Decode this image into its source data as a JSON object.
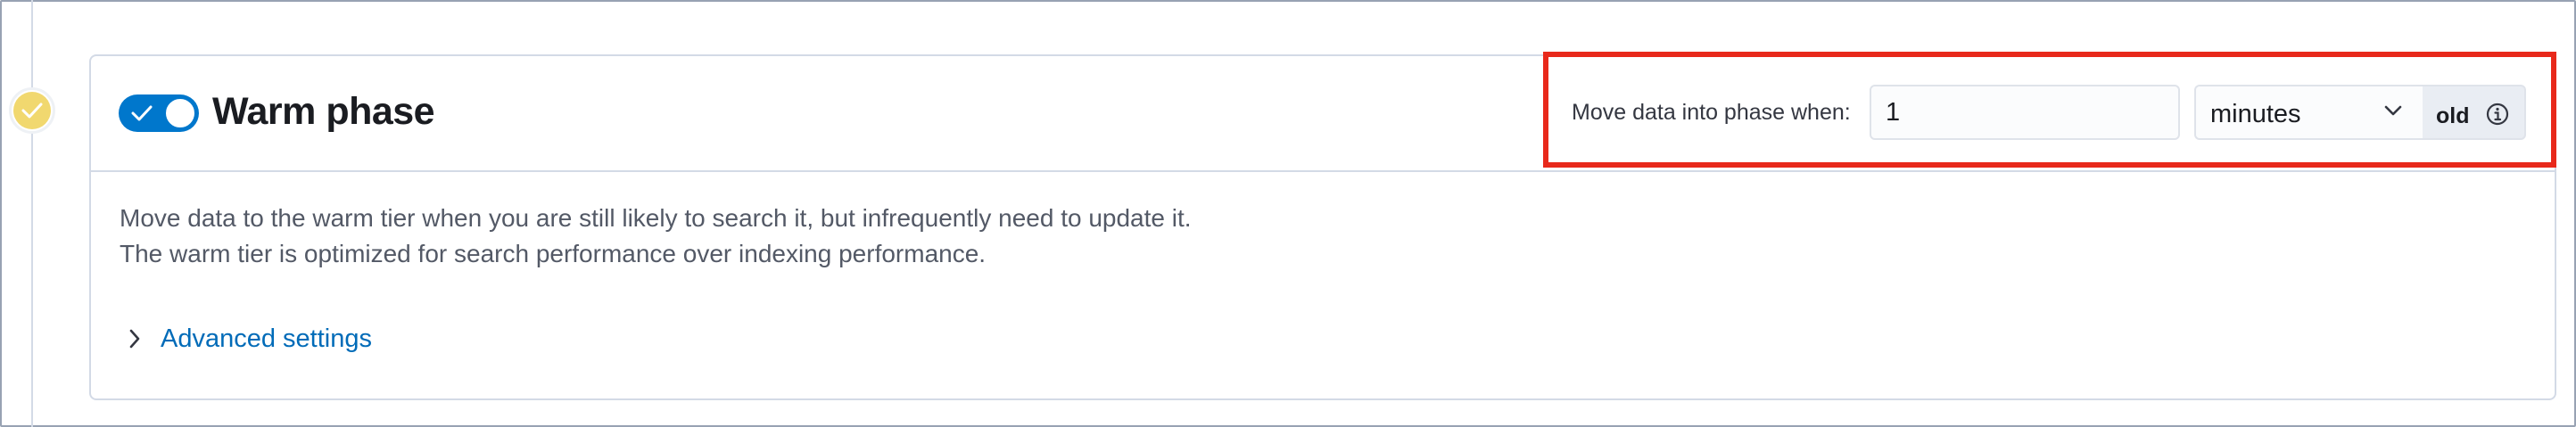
{
  "phase": {
    "title": "Warm phase",
    "toggle_on": true,
    "status_color": "#f1d86f",
    "description_line1": "Move data to the warm tier when you are still likely to search it, but infrequently need to update it.",
    "description_line2": "The warm tier is optimized for search performance over indexing performance.",
    "advanced_settings_label": "Advanced settings"
  },
  "min_age": {
    "label": "Move data into phase when:",
    "value": "1",
    "unit": "minutes",
    "append_text": "old"
  },
  "colors": {
    "accent": "#0077cc",
    "link": "#006bb8",
    "highlight": "#e8291b"
  },
  "icons": {
    "status": "check-icon",
    "toggle": "check-icon",
    "select": "chevron-down-icon",
    "info": "info-icon",
    "expand": "chevron-right-icon"
  }
}
